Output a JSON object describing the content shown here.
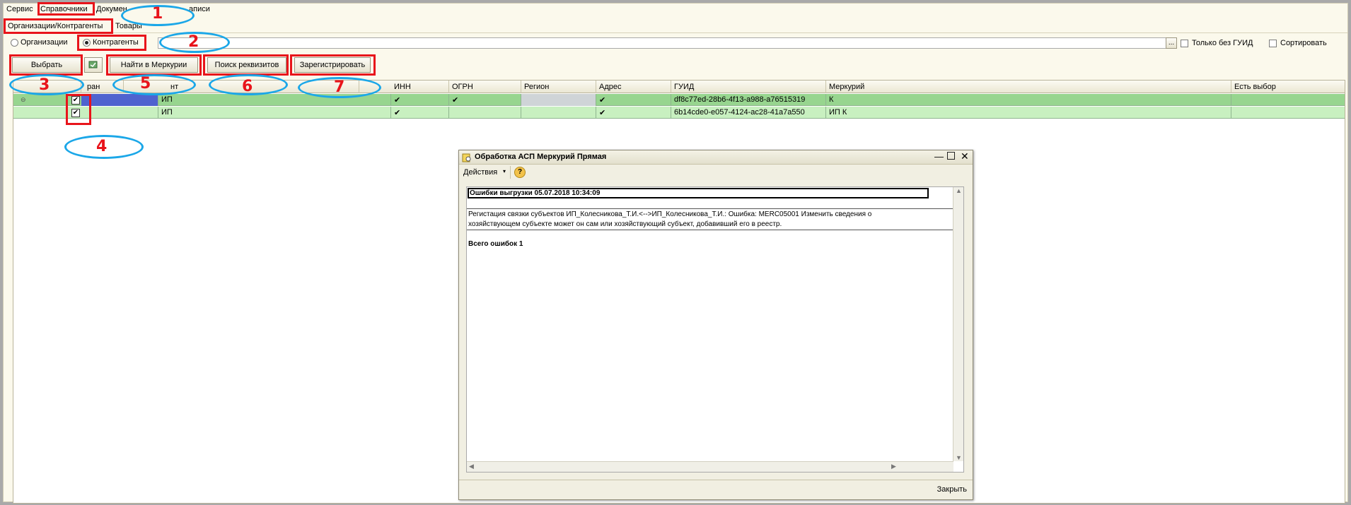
{
  "menu": {
    "items": [
      "Сервис",
      "Справочники",
      "Докумен",
      "аписи"
    ]
  },
  "tabs": [
    "Организации/Контрагенты",
    "Товары"
  ],
  "filter": {
    "org_label": "Организации",
    "contractor_label": "Контрагенты",
    "dots": "...",
    "only_no_guid": "Только без ГУИД",
    "sort": "Сортировать"
  },
  "toolbar": {
    "select": "Выбрать",
    "find_mercury": "Найти в Меркурии",
    "search_details": "Поиск реквизитов",
    "register": "Зарегистрировать"
  },
  "annotations": [
    "1",
    "2",
    "3",
    "4",
    "5",
    "6",
    "7"
  ],
  "grid": {
    "headers": [
      "ран",
      "нт",
      "ИНН",
      "ОГРН",
      "Регион",
      "Адрес",
      "ГУИД",
      "Меркурий",
      "Есть выбор"
    ],
    "rows": [
      {
        "kontragent": "ИП",
        "inn": "✔",
        "ogrn": "✔",
        "address": "✔",
        "guid": "df8c77ed-28b6-4f13-a988-a76515319",
        "mercury": "К"
      },
      {
        "kontragent": "ИП",
        "inn": "✔",
        "ogrn": "",
        "address": "✔",
        "guid": "6b14cde0-e057-4124-ac28-41a7a550",
        "mercury": "ИП К"
      }
    ]
  },
  "dialog": {
    "title": "Обработка  АСП Меркурий Прямая",
    "actions": "Действия",
    "help": "?",
    "errors_header": "Ошибки выгрузки 05.07.2018 10:34:09",
    "error_line1": "Регистация связки субъектов  ИП_Колесникова_Т.И.<-->ИП_Колесникова_Т.И.: Ошибка: MERC05001 Изменить сведения о",
    "error_line2": "хозяйствующем субъекте может он сам или хозяйствующий субъект, добавивший его в реестр.",
    "total": "Всего ошибок 1",
    "close": "Закрыть"
  },
  "colors": {
    "highlight_red": "#e8141b",
    "annotation_blue": "#1ba7e8",
    "row_green_dark": "#97d58f",
    "row_green_light": "#c8f0c0",
    "selected_blue": "#4f63cf"
  }
}
